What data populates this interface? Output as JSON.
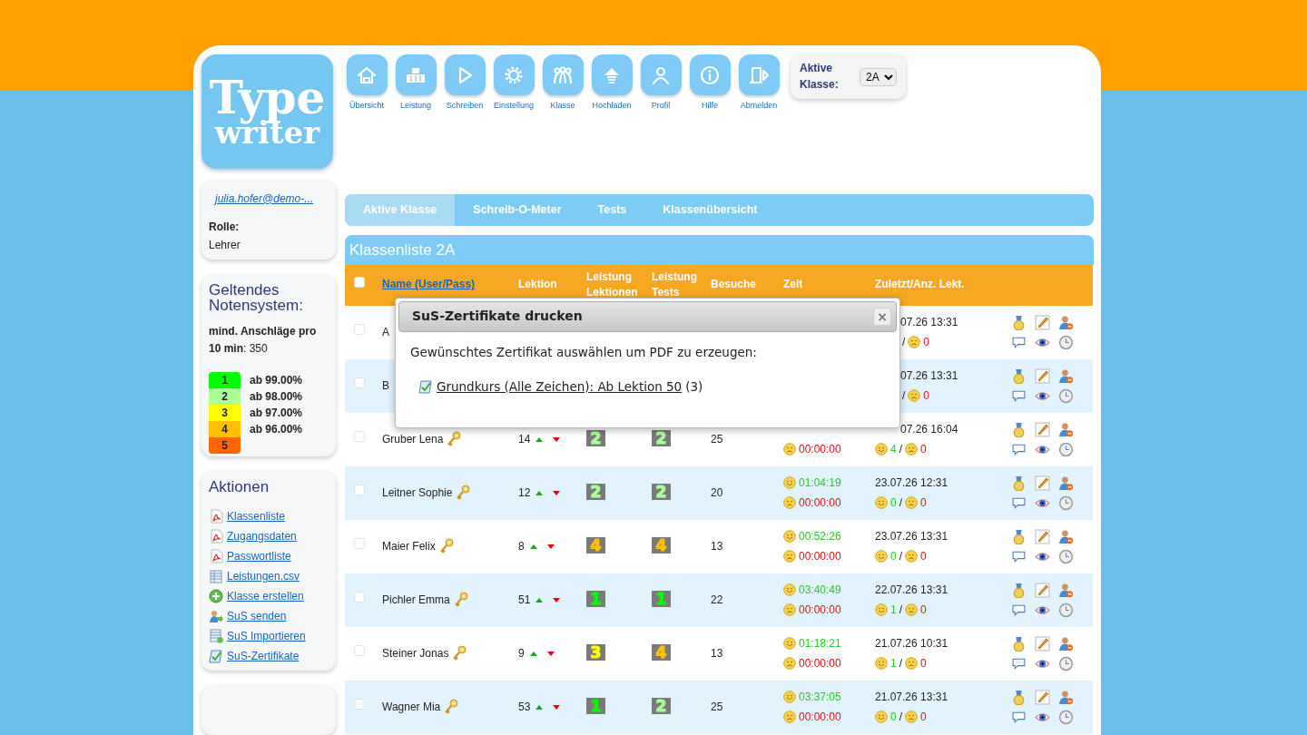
{
  "logo": {
    "line1": "Type",
    "line2": "writer"
  },
  "nav": [
    {
      "label": "Übersicht"
    },
    {
      "label": "Leistung"
    },
    {
      "label": "Schreiben"
    },
    {
      "label": "Einstellung"
    },
    {
      "label": "Klasse"
    },
    {
      "label": "Hochladen"
    },
    {
      "label": "Profil"
    },
    {
      "label": "Hilfe"
    },
    {
      "label": "Abmelden"
    }
  ],
  "class_select": {
    "label": "Aktive Klasse:",
    "value": "2A"
  },
  "user": {
    "email": "julia.hofer@demo-...",
    "role_label": "Rolle:",
    "role": "Lehrer"
  },
  "grading": {
    "title": "Geltendes Notensystem:",
    "min_text": "**mind. Anschläge pro 10 min**: 350",
    "grades": [
      {
        "grade": "1",
        "color": "#00ff00",
        "threshold": "ab 99.00%"
      },
      {
        "grade": "2",
        "color": "#aaff99",
        "threshold": "ab 98.00%"
      },
      {
        "grade": "3",
        "color": "#ffff00",
        "threshold": "ab 97.00%"
      },
      {
        "grade": "4",
        "color": "#ffc000",
        "threshold": "ab 96.00%"
      },
      {
        "grade": "5",
        "color": "#ff6600"
      }
    ]
  },
  "actions": {
    "title": "Aktionen",
    "items": [
      {
        "label": "Klassenliste",
        "kind": "pdf"
      },
      {
        "label": "Zugangsdaten",
        "kind": "pdf"
      },
      {
        "label": "Passwortliste",
        "kind": "pdf"
      },
      {
        "label": "Leistungen.csv",
        "kind": "sheet"
      },
      {
        "label": "Klasse erstellen",
        "kind": "add"
      },
      {
        "label": "SuS senden",
        "kind": "send"
      },
      {
        "label": "SuS Importieren",
        "kind": "import"
      },
      {
        "label": "SuS-Zertifikate",
        "kind": "certificate"
      }
    ]
  },
  "tabs": [
    {
      "label": "Aktive Klasse",
      "selected": true
    },
    {
      "label": "Schreib-O-Meter",
      "selected": false
    },
    {
      "label": "Tests",
      "selected": false
    },
    {
      "label": "Klassenübersicht",
      "selected": false
    }
  ],
  "list_title": "Klassenliste 2A",
  "table": {
    "select_all": {
      "checked": false
    },
    "columns": [
      "Name (User/Pass)",
      "Lektion",
      "Leistung Lektionen",
      "Leistung Tests",
      "Besuche",
      "Zeit",
      "Zuletzt/Anz. Lekt."
    ],
    "rows": [
      {
        "checked": false,
        "name": "A",
        "key": false,
        "last": "07.26 13:31",
        "last_cut": true,
        "sep": "/",
        "fail_count": "0"
      },
      {
        "checked": false,
        "name": "B",
        "key": false,
        "last": "07.26 13:31",
        "last_cut": true,
        "sep": "/",
        "fail_count": "0"
      },
      {
        "checked": false,
        "name": "Gruber Lena",
        "key": true,
        "lesson": "14",
        "grade_lessons": "2",
        "grade_tests": "2",
        "visits": "25",
        "time_fail": "00:00:00",
        "last": "07.26 16:04",
        "last_cut": true,
        "ok_count": "4",
        "sep": "/",
        "fail_count": "0"
      },
      {
        "checked": false,
        "name": "Leitner Sophie",
        "key": true,
        "lesson": "12",
        "grade_lessons": "2",
        "grade_tests": "2",
        "visits": "20",
        "time_ok": "01:04:19",
        "time_fail": "00:00:00",
        "last": "23.07.26 12:31",
        "last_cut": false,
        "ok_count": "0",
        "sep": "/",
        "fail_count": "0"
      },
      {
        "checked": false,
        "name": "Maier Felix",
        "key": true,
        "lesson": "8",
        "grade_lessons": "4",
        "grade_tests": "4",
        "visits": "13",
        "time_ok": "00:52:26",
        "time_fail": "00:00:00",
        "last": "23.07.26 13:31",
        "last_cut": false,
        "ok_count": "0",
        "sep": "/",
        "fail_count": "0"
      },
      {
        "checked": false,
        "name": "Pichler Emma",
        "key": true,
        "lesson": "51",
        "grade_lessons": "1",
        "grade_tests": "1",
        "visits": "22",
        "time_ok": "03:40:49",
        "time_fail": "00:00:00",
        "last": "22.07.26 13:31",
        "last_cut": false,
        "ok_count": "1",
        "sep": "/",
        "fail_count": "0"
      },
      {
        "checked": false,
        "name": "Steiner Jonas",
        "key": true,
        "lesson": "9",
        "grade_lessons": "3",
        "grade_tests": "4",
        "visits": "13",
        "time_ok": "01:18:21",
        "time_fail": "00:00:00",
        "last": "21.07.26 10:31",
        "last_cut": false,
        "ok_count": "1",
        "sep": "/",
        "fail_count": "0"
      },
      {
        "checked": false,
        "name": "Wagner Mia",
        "key": true,
        "lesson": "53",
        "grade_lessons": "1",
        "grade_tests": "2",
        "visits": "25",
        "time_ok": "03:37:05",
        "time_fail": "00:00:00",
        "last": "21.07.26 13:31",
        "last_cut": false,
        "ok_count": "0",
        "sep": "/",
        "fail_count": "0"
      }
    ]
  },
  "modal": {
    "title": "SuS-Zertifikate drucken",
    "text": "Gewünschtes Zertifikat auswählen um PDF zu erzeugen:",
    "link": "Grundkurs (Alle Zeichen): Ab Lektion 50",
    "count": "(3)",
    "close": "×"
  }
}
